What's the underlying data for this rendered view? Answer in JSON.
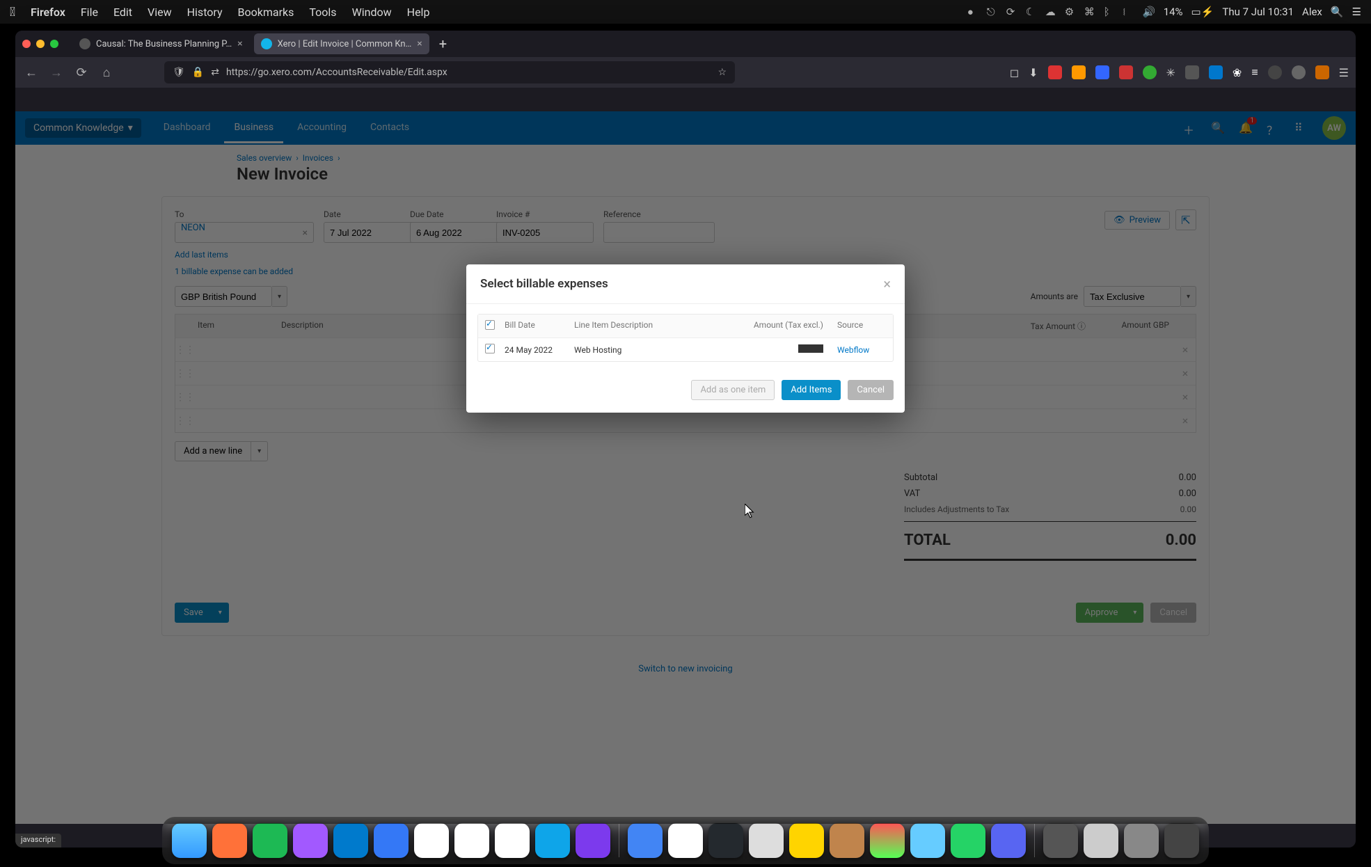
{
  "menubar": {
    "app": "Firefox",
    "items": [
      "File",
      "Edit",
      "View",
      "History",
      "Bookmarks",
      "Tools",
      "Window",
      "Help"
    ],
    "battery": "14%",
    "clock": "Thu 7 Jul  10:31",
    "user": "Alex"
  },
  "tabs": {
    "tab1": "Causal: The Business Planning P…",
    "tab2": "Xero | Edit Invoice | Common Kn…"
  },
  "urlbar": "https://go.xero.com/AccountsReceivable/Edit.aspx",
  "xero": {
    "org": "Common Knowledge",
    "nav": {
      "dashboard": "Dashboard",
      "business": "Business",
      "accounting": "Accounting",
      "contacts": "Contacts"
    },
    "notif_count": "1",
    "avatar": "AW"
  },
  "breadcrumb": {
    "a": "Sales overview",
    "b": "Invoices"
  },
  "page_title": "New Invoice",
  "form": {
    "to_label": "To",
    "to_value": "NEON",
    "date_label": "Date",
    "date_value": "7 Jul 2022",
    "due_label": "Due Date",
    "due_value": "6 Aug 2022",
    "inv_label": "Invoice #",
    "inv_value": "INV-0205",
    "ref_label": "Reference",
    "ref_value": "",
    "preview": "Preview",
    "add_last": "Add last items",
    "billable_msg": "1 billable expense can be added",
    "currency": "GBP British Pound",
    "amounts_are": "Amounts are",
    "tax_mode": "Tax Exclusive",
    "cols": {
      "item": "Item",
      "desc": "Description",
      "tax": "Tax Amount",
      "amt": "Amount GBP"
    },
    "add_line": "Add a new line"
  },
  "totals": {
    "subtotal_label": "Subtotal",
    "subtotal": "0.00",
    "vat_label": "VAT",
    "vat": "0.00",
    "adj_label": "Includes Adjustments to Tax",
    "adj": "0.00",
    "total_label": "TOTAL",
    "total": "0.00"
  },
  "actions": {
    "save": "Save",
    "approve": "Approve",
    "cancel": "Cancel"
  },
  "switch_link": "Switch to new invoicing",
  "modal": {
    "title": "Select billable expenses",
    "cols": {
      "date": "Bill Date",
      "desc": "Line Item Description",
      "amt": "Amount (Tax excl.)",
      "src": "Source"
    },
    "row": {
      "date": "24 May 2022",
      "desc": "Web Hosting",
      "src": "Webflow"
    },
    "add_one": "Add as one item",
    "add_items": "Add Items",
    "cancel": "Cancel"
  },
  "statusbar": "javascript:"
}
